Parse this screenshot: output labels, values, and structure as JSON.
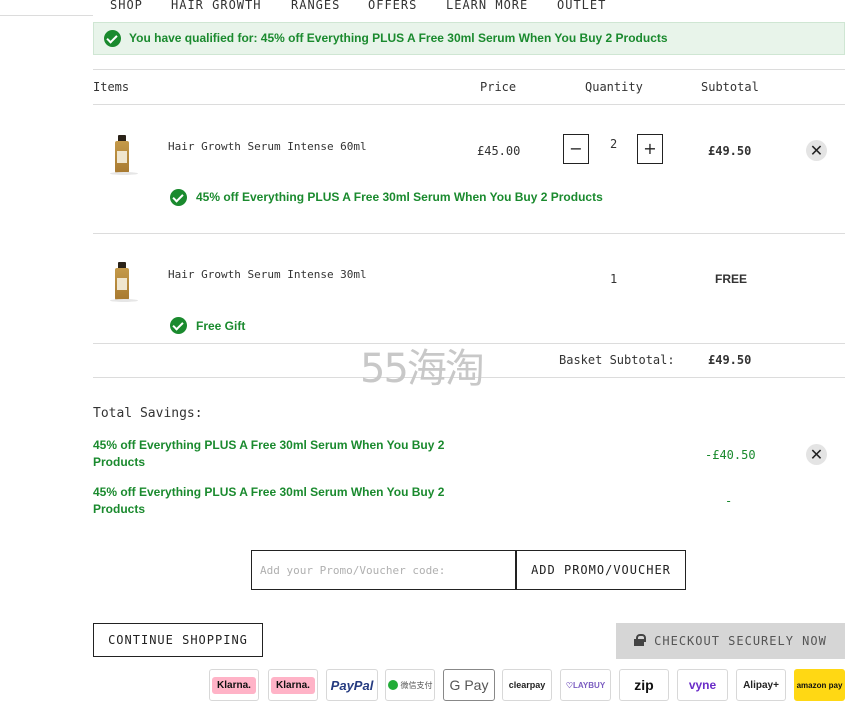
{
  "nav": [
    "SHOP",
    "HAIR GROWTH",
    "RANGES",
    "OFFERS",
    "LEARN MORE",
    "OUTLET"
  ],
  "banner": {
    "text": "You have qualified for: 45% off Everything PLUS A Free 30ml Serum When You Buy 2 Products"
  },
  "table": {
    "headers": {
      "items": "Items",
      "price": "Price",
      "quantity": "Quantity",
      "subtotal": "Subtotal"
    },
    "rows": [
      {
        "name": "Hair Growth Serum Intense 60ml",
        "price": "£45.00",
        "quantity": "2",
        "subtotal": "£49.50",
        "promo": "45% off Everything PLUS A Free 30ml Serum When You Buy 2 Products"
      },
      {
        "name": "Hair Growth Serum Intense 30ml",
        "price": "",
        "quantity": "1",
        "subtotal": "FREE",
        "promo": "Free Gift"
      }
    ],
    "basket_subtotal_label": "Basket Subtotal:",
    "basket_subtotal_value": "£49.50"
  },
  "watermark": "55海淘",
  "savings": {
    "title": "Total Savings:",
    "items": [
      {
        "text": "45% off Everything PLUS A Free 30ml Serum When You Buy 2 Products",
        "amount": "-£40.50"
      },
      {
        "text": "45% off Everything PLUS A Free 30ml Serum When You Buy 2 Products",
        "amount": "-"
      }
    ]
  },
  "promo": {
    "placeholder": "Add your Promo/Voucher code:",
    "button": "ADD PROMO/VOUCHER"
  },
  "actions": {
    "continue": "CONTINUE SHOPPING",
    "checkout": "CHECKOUT SECURELY NOW"
  },
  "payment_methods": [
    {
      "name": "klarna",
      "label": "Klarna."
    },
    {
      "name": "klarna-2",
      "label": "Klarna."
    },
    {
      "name": "paypal",
      "label": "PayPal"
    },
    {
      "name": "wechat-pay",
      "label": "微信支付"
    },
    {
      "name": "google-pay",
      "label": "G Pay"
    },
    {
      "name": "clearpay",
      "label": "clearpay"
    },
    {
      "name": "laybuy",
      "label": "LAYBUY"
    },
    {
      "name": "zip",
      "label": "zip"
    },
    {
      "name": "vyne",
      "label": "vyne"
    },
    {
      "name": "alipay",
      "label": "Alipay+"
    },
    {
      "name": "amazon-pay",
      "label": "amazon pay"
    }
  ],
  "colors": {
    "green": "#1a8a2e",
    "banner_bg": "#e8f4ea",
    "checkout_bg": "#d6d6d6",
    "klarna_pink": "#ffb3c7",
    "paypal_blue": "#253b80",
    "amazon_yellow": "#ffd814"
  }
}
